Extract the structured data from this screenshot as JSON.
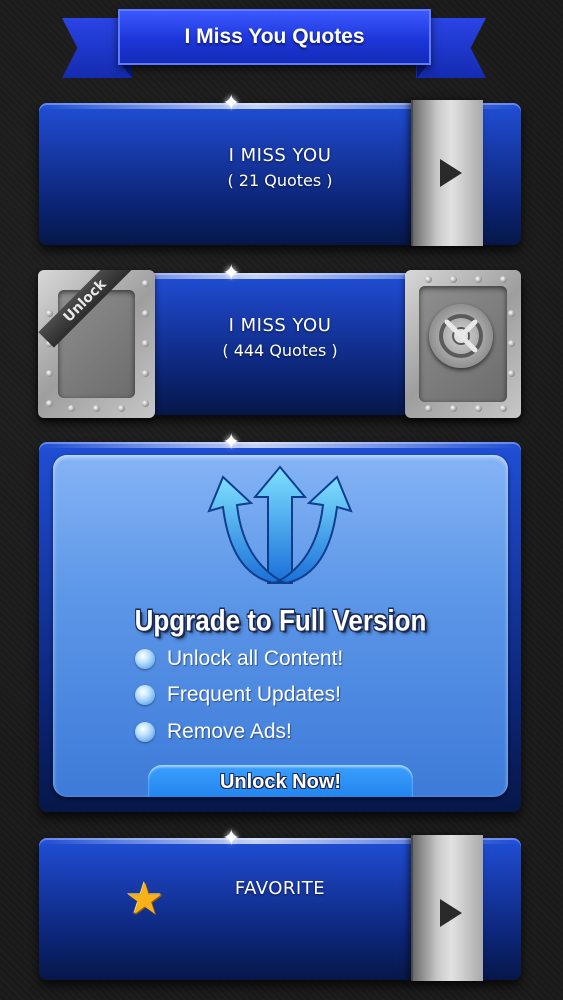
{
  "header": {
    "title": "I Miss You Quotes"
  },
  "categories": [
    {
      "title": "I MISS YOU",
      "subtitle": "( 21 Quotes )",
      "locked": false
    },
    {
      "title": "I MISS YOU",
      "subtitle": "( 444 Quotes )",
      "locked": true,
      "badge": "Unlock"
    }
  ],
  "upgrade": {
    "title": "Upgrade to Full Version",
    "features": [
      "Unlock all Content!",
      "Frequent Updates!",
      "Remove Ads!"
    ],
    "button_label": "Unlock Now!"
  },
  "favorite": {
    "title": "FAVORITE"
  },
  "colors": {
    "panel_blue": "#1a3fb5",
    "upgrade_blue": "#5d97e8",
    "star_gold": "#f7b21b"
  },
  "icons": [
    "play-icon",
    "vault-icon",
    "upgrade-arrows-icon",
    "bullet-icon",
    "star-icon"
  ]
}
